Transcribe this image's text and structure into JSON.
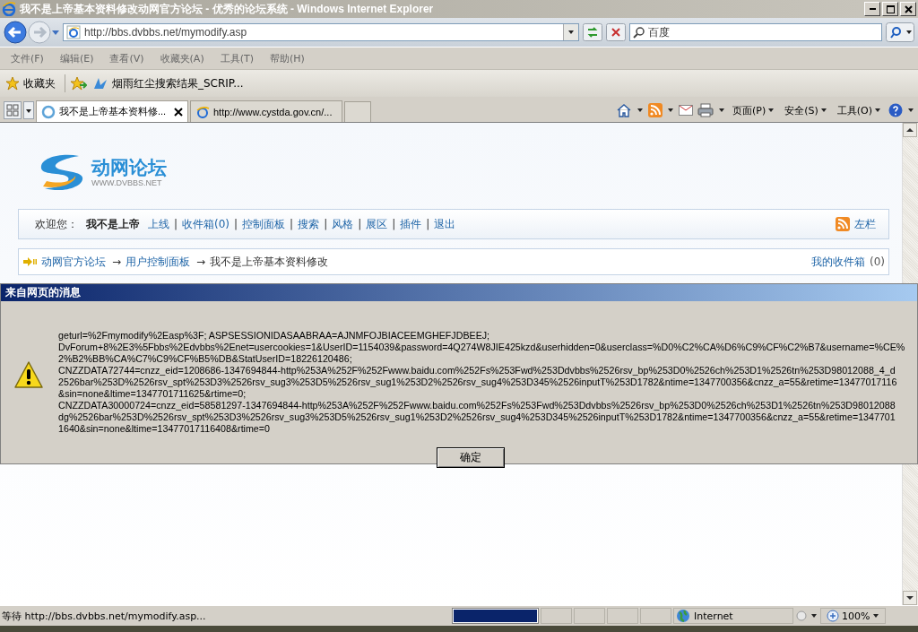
{
  "window": {
    "title": "我不是上帝基本资料修改动网官方论坛 - 优秀的论坛系统 - Windows Internet Explorer"
  },
  "address_bar": {
    "url": "http://bbs.dvbbs.net/mymodify.asp"
  },
  "search": {
    "placeholder": "百度"
  },
  "menu": [
    "文件(F)",
    "编辑(E)",
    "查看(V)",
    "收藏夹(A)",
    "工具(T)",
    "帮助(H)"
  ],
  "favorites_bar": {
    "label": "收藏夹",
    "links": [
      "烟雨红尘搜索结果_SCRIP..."
    ]
  },
  "tabs": [
    {
      "label": "我不是上帝基本资料修...",
      "selected": true
    },
    {
      "label": "http://www.cystda.gov.cn/...",
      "selected": false
    }
  ],
  "command_bar": [
    "页面(P)",
    "安全(S)",
    "工具(O)"
  ],
  "page": {
    "logo_title": "动网论坛",
    "logo_subtitle": "WWW.DVBBS.NET",
    "welcome_label": "欢迎您：",
    "username": "我不是上帝",
    "nav_links": [
      {
        "label": "上线",
        "separator": "|"
      },
      {
        "label": "收件箱(0)",
        "separator": "|"
      },
      {
        "label": "控制面板",
        "separator": "|"
      },
      {
        "label": "搜索",
        "separator": "|"
      },
      {
        "label": "风格",
        "separator": "|"
      },
      {
        "label": "展区",
        "separator": "|"
      },
      {
        "label": "插件",
        "separator": "|"
      },
      {
        "label": "退出"
      }
    ],
    "sidebar_toggle": "左栏",
    "breadcrumb": [
      {
        "label": "动网官方论坛",
        "kind": "link"
      },
      {
        "label": "用户控制面板",
        "kind": "link",
        "separator": "→"
      },
      {
        "label": "我不是上帝基本资料修改",
        "kind": "current",
        "separator": "→"
      }
    ],
    "inbox_link": "我的收件箱",
    "inbox_count": "(0)"
  },
  "dialog": {
    "title": "来自网页的消息",
    "lines": [
      "geturl=%2Fmymodify%2Easp%3F; ASPSESSIONIDASAABRAA=AJNMFOJBIACEEMGHEFJDBEEJ;",
      "DvForum+8%2E3%5Fbbs%2Edvbbs%2Enet=usercookies=1&UserID=1154039&password=4Q274W8JIE425kzd&userhidden=0&userclass=%D0%C2%CA%D6%C9%CF%C2%B7&username=%CE%",
      "2%B2%BB%CA%C7%C9%CF%B5%DB&StatUserID=18226120486;",
      "CNZZDATA72744=cnzz_eid=1208686-1347694844-http%253A%252F%252Fwww.baidu.com%252Fs%253Fwd%253Ddvbbs%2526rsv_bp%253D0%2526ch%253D1%2526tn%253D98012088_4_d",
      "2526bar%253D%2526rsv_spt%253D3%2526rsv_sug3%253D5%2526rsv_sug1%253D2%2526rsv_sug4%253D345%2526inputT%253D1782&ntime=1347700356&cnzz_a=55&retime=13477017116",
      "&sin=none&ltime=1347701711625&rtime=0;",
      "CNZZDATA30000724=cnzz_eid=58581297-1347694844-http%253A%252F%252Fwww.baidu.com%252Fs%253Fwd%253Ddvbbs%2526rsv_bp%253D0%2526ch%253D1%2526tn%253D98012088",
      "dg%2526bar%253D%2526rsv_spt%253D3%2526rsv_sug3%253D5%2526rsv_sug1%253D2%2526rsv_sug4%253D345%2526inputT%253D1782&ntime=1347700356&cnzz_a=55&retime=1347701",
      "1640&sin=none&ltime=13477017116408&rtime=0"
    ],
    "button": "确定"
  },
  "status_bar": {
    "text": "等待 http://bbs.dvbbs.net/mymodify.asp...",
    "progress": {
      "level": 1
    },
    "zone": "Internet",
    "zoom": "100%"
  }
}
